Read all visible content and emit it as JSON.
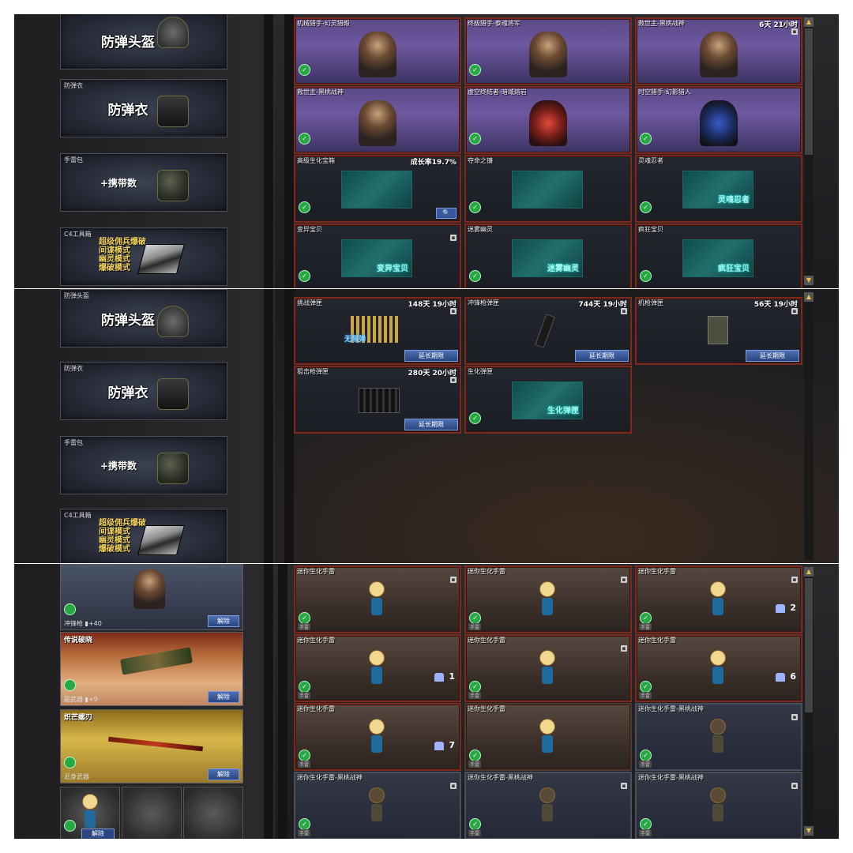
{
  "panel1": {
    "side": [
      {
        "label": "",
        "big": "防弹头盔",
        "type": "helmet"
      },
      {
        "label": "防弹衣",
        "big": "防弹衣",
        "type": "vest"
      },
      {
        "label": "手雷包",
        "small": "+携带数",
        "type": "grenade"
      },
      {
        "label": "C4工具箱",
        "modes": [
          "超级佣兵爆破",
          "间谍模式",
          "幽灵模式",
          "爆破模式"
        ],
        "type": "c4"
      }
    ],
    "cards": [
      {
        "name": "机械猎手-幻灵猎殿",
        "time": "",
        "style": "purple"
      },
      {
        "name": "终极猎手-泰魂将军",
        "time": "",
        "style": "purple"
      },
      {
        "name": "救世主-黑桃战神",
        "time": "6天 21小时",
        "style": "purple"
      },
      {
        "name": "救世主-黑桃战神",
        "time": "",
        "style": "purple"
      },
      {
        "name": "虚空终结者-暗域熔岩",
        "time": "",
        "style": "purple"
      },
      {
        "name": "时空猎手-幻影猎人",
        "time": "",
        "style": "purple"
      },
      {
        "name": "高级生化宝箱",
        "time": "成长率19.7%",
        "style": "dark",
        "hex": ""
      },
      {
        "name": "夺命之镰",
        "time": "",
        "style": "dark",
        "hex": ""
      },
      {
        "name": "灵魂忍者",
        "time": "",
        "style": "dark",
        "hex": "灵魂忍者"
      },
      {
        "name": "变异宝贝",
        "time": "",
        "style": "dark",
        "hex": "变异宝贝"
      },
      {
        "name": "迷雾幽灵",
        "time": "",
        "style": "dark",
        "hex": "迷雾幽灵"
      },
      {
        "name": "疯狂宝贝",
        "time": "",
        "style": "dark",
        "hex": "疯狂宝贝"
      }
    ]
  },
  "panel2": {
    "side": [
      {
        "label": "防弹头盔",
        "big": "防弹头盔"
      },
      {
        "label": "防弹衣",
        "big": "防弹衣"
      },
      {
        "label": "手雷包",
        "small": "+携带数"
      },
      {
        "label": "C4工具箱",
        "modes": [
          "超级佣兵爆破",
          "间谍模式",
          "幽灵模式",
          "爆破模式"
        ]
      }
    ],
    "cards": [
      {
        "name": "挑战弹匣",
        "time": "148天 19小时",
        "ext": "延长期限",
        "pic_text": "无限弹"
      },
      {
        "name": "冲锋枪弹匣",
        "time": "744天 19小时",
        "ext": "延长期限"
      },
      {
        "name": "机枪弹匣",
        "time": "56天 19小时",
        "ext": "延长期限"
      },
      {
        "name": "狙击枪弹匣",
        "time": "280天 20小时",
        "ext": "延长期限"
      },
      {
        "name": "生化弹匣",
        "time": "",
        "hex": "生化弹匣"
      }
    ]
  },
  "panel3": {
    "equipped": [
      {
        "title": "",
        "meta": "冲锋枪 ▮+40",
        "button": "解除"
      },
      {
        "title": "传说破晓",
        "meta": "副武器 ▮+9",
        "button": "解除"
      },
      {
        "title": "炽芒螺刃",
        "meta": "近身武器",
        "button": "解除"
      }
    ],
    "slot_button": "解除",
    "cards": [
      {
        "name": "迷你生化手雷",
        "tag": "手雷",
        "count": ""
      },
      {
        "name": "迷你生化手雷",
        "tag": "手雷",
        "count": ""
      },
      {
        "name": "迷你生化手雷",
        "tag": "手雷",
        "count": "2"
      },
      {
        "name": "迷你生化手雷",
        "tag": "手雷",
        "count": "1"
      },
      {
        "name": "迷你生化手雷",
        "tag": "手雷",
        "count": ""
      },
      {
        "name": "迷你生化手雷",
        "tag": "手雷",
        "count": "6"
      },
      {
        "name": "迷你生化手雷",
        "tag": "手雷",
        "count": "7"
      },
      {
        "name": "迷你生化手雷",
        "tag": "手雷",
        "count": ""
      },
      {
        "name": "迷你生化手雷-黑桃战神",
        "tag": "手雷",
        "count": ""
      },
      {
        "name": "迷你生化手雷-黑桃战神",
        "tag": "手雷",
        "count": ""
      },
      {
        "name": "迷你生化手雷-黑桃战神",
        "tag": "手雷",
        "count": ""
      },
      {
        "name": "迷你生化手雷-黑桃战神",
        "tag": "手雷",
        "count": ""
      }
    ]
  }
}
